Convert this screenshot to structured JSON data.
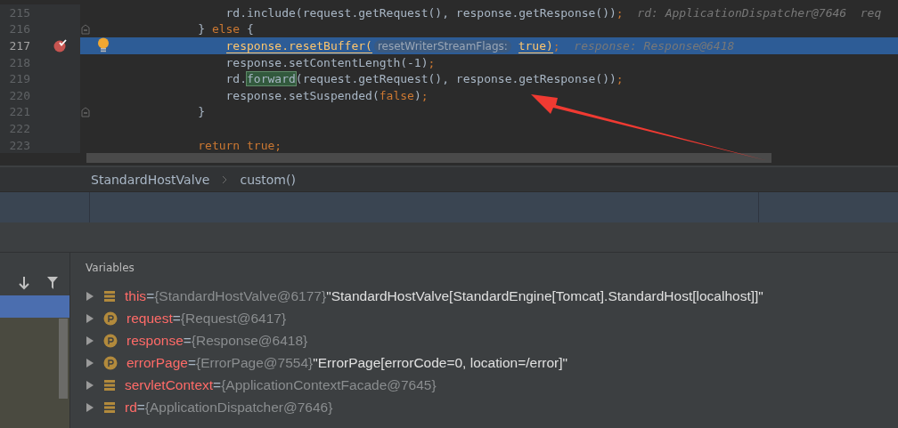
{
  "editor": {
    "lines": [
      {
        "number": "215",
        "current": false,
        "breakpoint": false,
        "bulb": false,
        "fold": false,
        "segments": [
          {
            "kind": "plain",
            "text": "                    rd.include(request.getRequest(), response.getResponse())"
          },
          {
            "kind": "keyword",
            "text": ";"
          },
          {
            "kind": "hint",
            "text": "  rd: ApplicationDispatcher@7646  req"
          }
        ]
      },
      {
        "number": "216",
        "current": false,
        "breakpoint": false,
        "bulb": false,
        "fold": true,
        "segments": [
          {
            "kind": "plain",
            "text": "                }"
          },
          {
            "kind": "keyword",
            "text": " else "
          },
          {
            "kind": "plain",
            "text": "{"
          }
        ]
      },
      {
        "number": "217",
        "current": true,
        "breakpoint": true,
        "bulb": true,
        "fold": false,
        "segments": [
          {
            "kind": "exec",
            "text": "                    response.resetBuffer("
          },
          {
            "kind": "param",
            "text": "resetWriterStreamFlags:"
          },
          {
            "kind": "exec",
            "text": " true)"
          },
          {
            "kind": "keyword",
            "text": ";"
          },
          {
            "kind": "hint",
            "text": "  response: Response@6418"
          }
        ]
      },
      {
        "number": "218",
        "current": false,
        "breakpoint": false,
        "bulb": false,
        "fold": false,
        "segments": [
          {
            "kind": "plain",
            "text": "                    response.setContentLength(-1)"
          },
          {
            "kind": "keyword",
            "text": ";"
          }
        ]
      },
      {
        "number": "219",
        "current": false,
        "breakpoint": false,
        "bulb": false,
        "fold": false,
        "segments": [
          {
            "kind": "plain",
            "text": "                    rd."
          },
          {
            "kind": "match",
            "text": "forward"
          },
          {
            "kind": "plain",
            "text": "(request.getRequest(), response.getResponse())"
          },
          {
            "kind": "keyword",
            "text": ";"
          }
        ]
      },
      {
        "number": "220",
        "current": false,
        "breakpoint": false,
        "bulb": false,
        "fold": false,
        "segments": [
          {
            "kind": "plain",
            "text": "                    response.setSuspended("
          },
          {
            "kind": "keyword",
            "text": "false"
          },
          {
            "kind": "plain",
            "text": ")"
          },
          {
            "kind": "keyword",
            "text": ";"
          }
        ]
      },
      {
        "number": "221",
        "current": false,
        "breakpoint": false,
        "bulb": false,
        "fold": true,
        "segments": [
          {
            "kind": "plain",
            "text": "                }"
          }
        ]
      },
      {
        "number": "222",
        "current": false,
        "breakpoint": false,
        "bulb": false,
        "fold": false
      },
      {
        "number": "223",
        "current": false,
        "breakpoint": false,
        "bulb": false,
        "fold": false,
        "segments": [
          {
            "kind": "keyword",
            "text": "                return true;"
          }
        ]
      }
    ]
  },
  "breadcrumb": [
    "StandardHostValve",
    "custom()"
  ],
  "variables": {
    "title": "Variables",
    "items": [
      {
        "kind": "field",
        "name": "this",
        "op": "=",
        "type": "{StandardHostValve@6177}",
        "value": "\"StandardHostValve[StandardEngine[Tomcat].StandardHost[localhost]]\""
      },
      {
        "kind": "param",
        "name": "request",
        "op": "=",
        "type": "{Request@6417}"
      },
      {
        "kind": "param",
        "name": "response",
        "op": "=",
        "type": "{Response@6418}"
      },
      {
        "kind": "param",
        "name": "errorPage",
        "op": "=",
        "type": "{ErrorPage@7554}",
        "value": "\"ErrorPage[errorCode=0, location=/error]\""
      },
      {
        "kind": "field",
        "name": "servletContext",
        "op": "=",
        "type": "{ApplicationContextFacade@7645}"
      },
      {
        "kind": "field",
        "name": "rd",
        "op": "=",
        "type": "{ApplicationDispatcher@7646}"
      }
    ]
  }
}
